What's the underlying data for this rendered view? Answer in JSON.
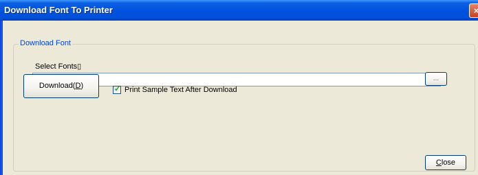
{
  "window": {
    "title": "Download Font To Printer",
    "close_glyph": "×"
  },
  "group": {
    "legend": "Download Font",
    "select_label": "Select Fonts▯",
    "path_value": "",
    "browse_label": "..."
  },
  "download_button": {
    "label_prefix": "Download(",
    "accel": "D",
    "label_suffix": ")"
  },
  "print_sample": {
    "checked": true,
    "label": "Print Sample Text After Download"
  },
  "close_button": {
    "accel": "C",
    "label_rest": "lose"
  }
}
